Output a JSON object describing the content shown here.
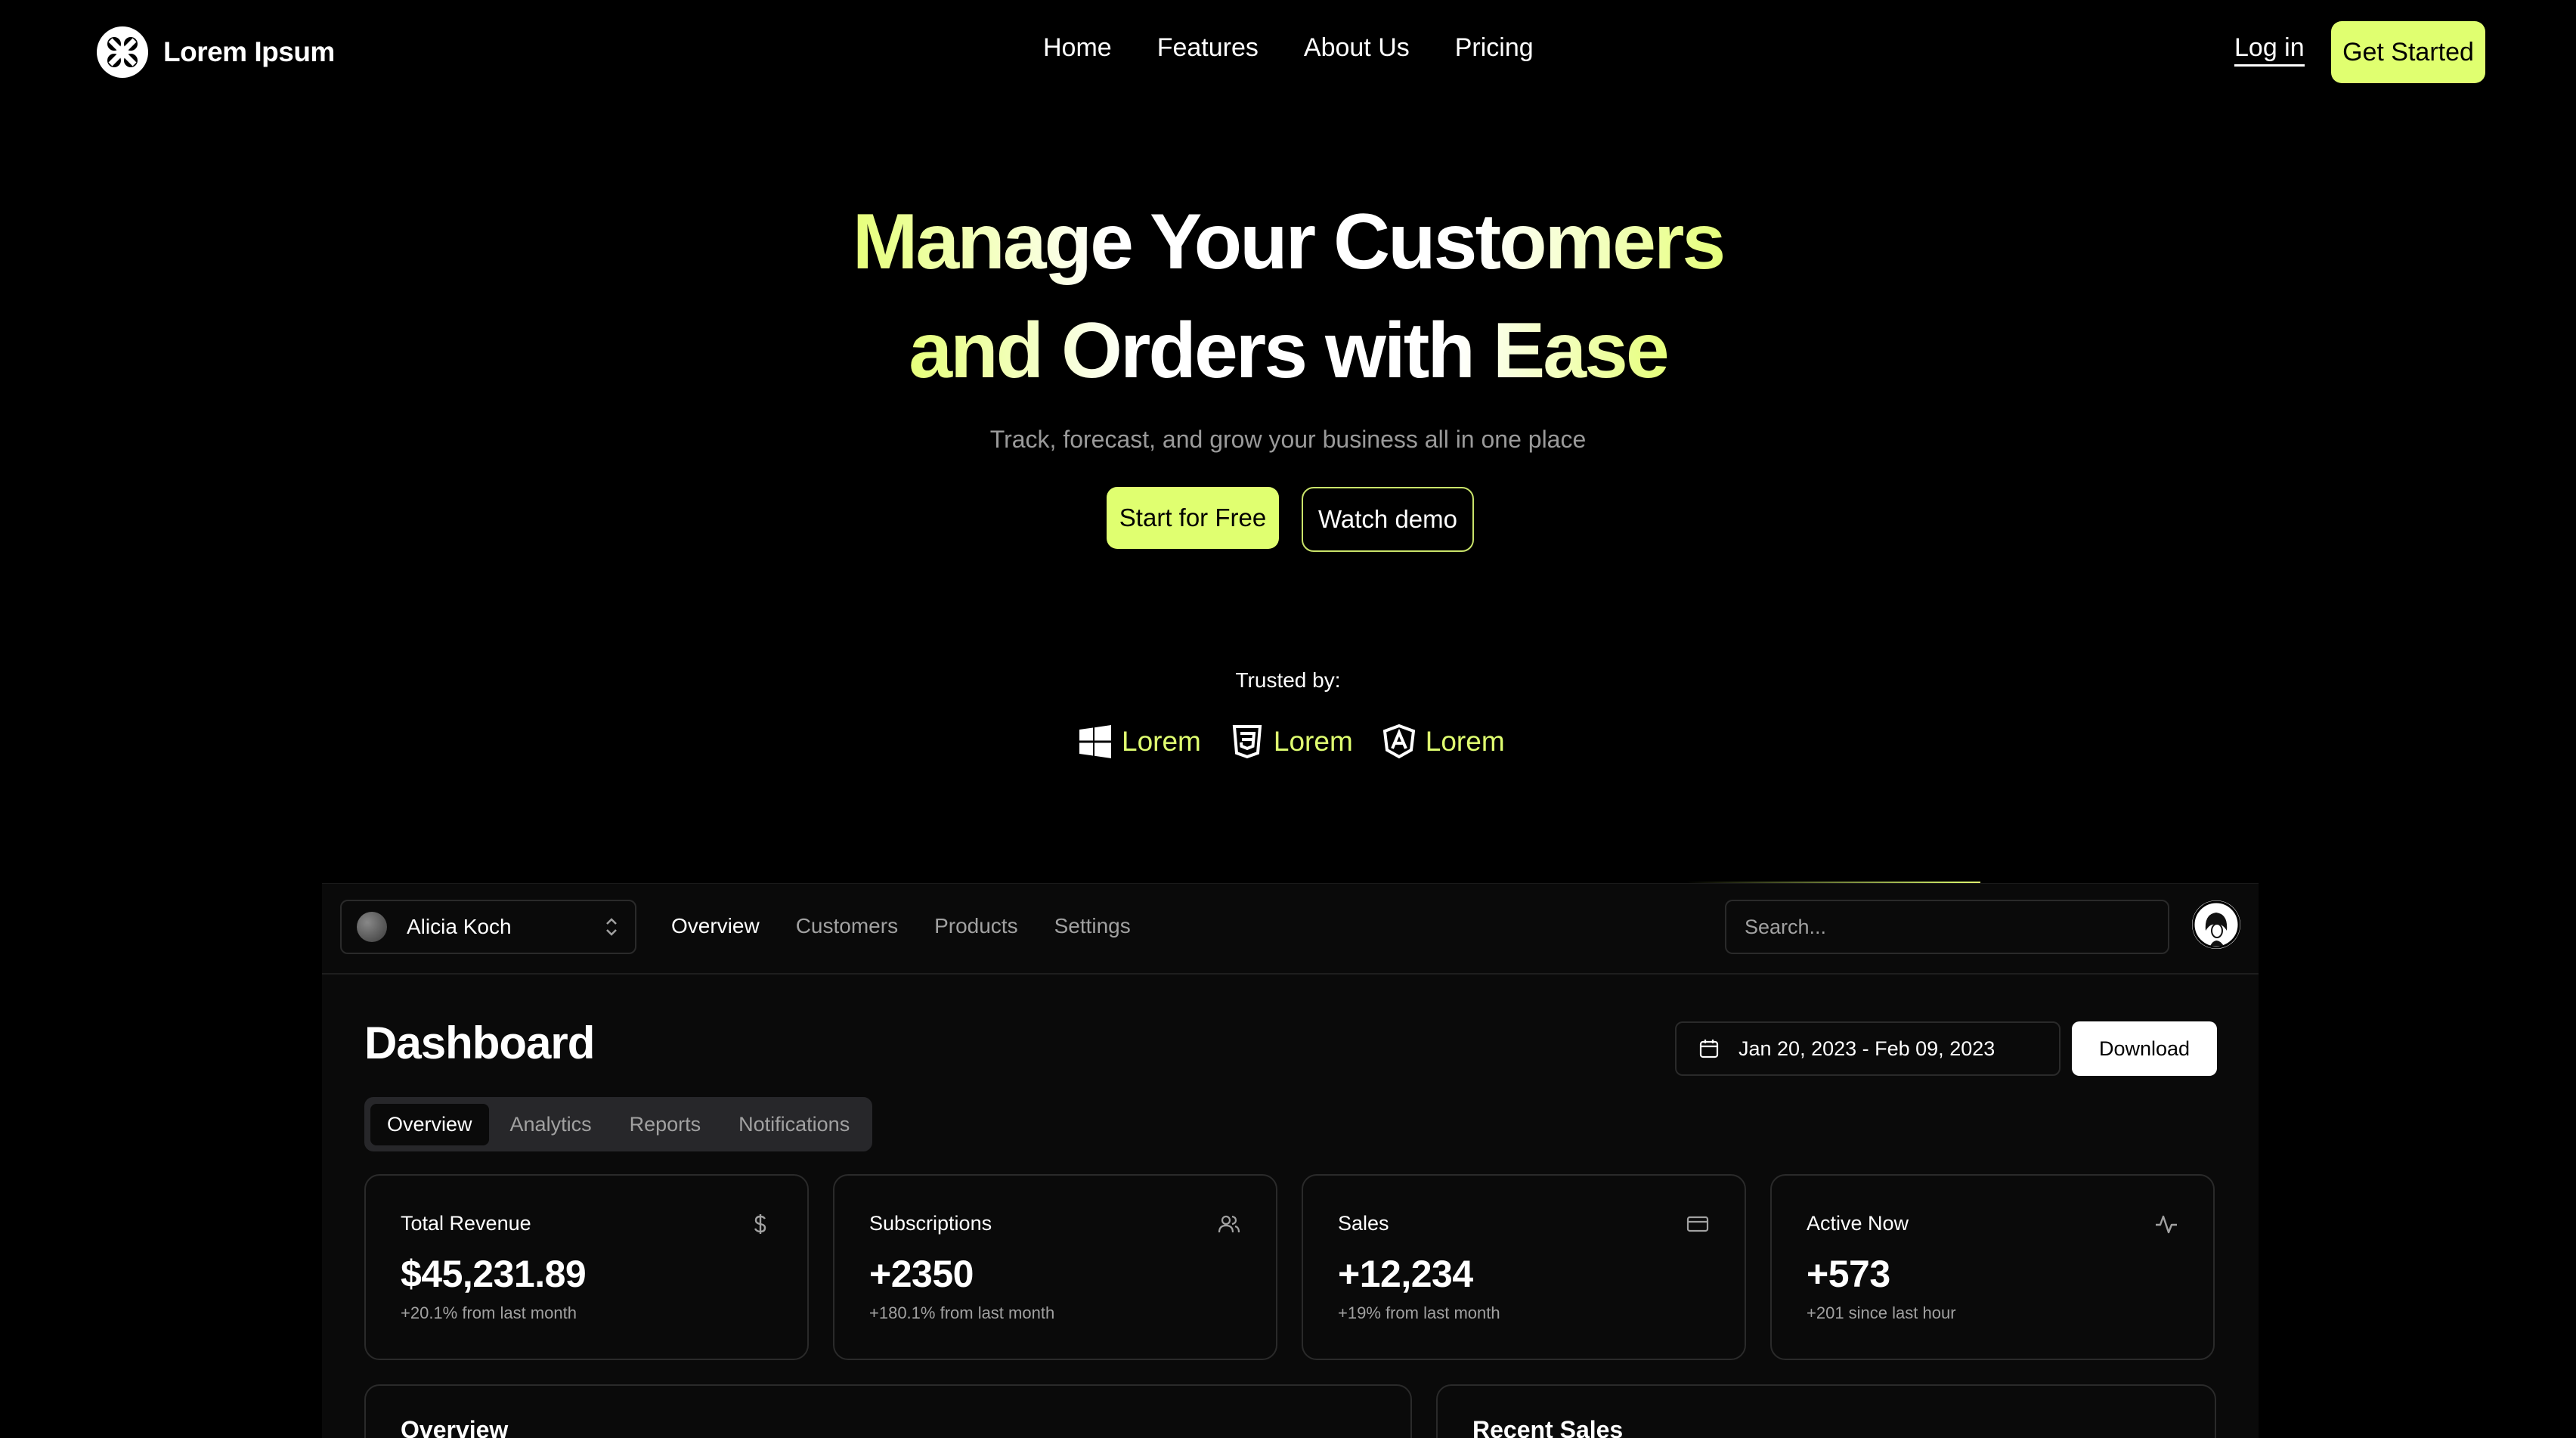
{
  "nav": {
    "brand": "Lorem Ipsum",
    "links": [
      "Home",
      "Features",
      "About Us",
      "Pricing"
    ],
    "login": "Log in",
    "cta": "Get Started"
  },
  "hero": {
    "title_line1": "Manage Your Customers",
    "title_line2": "and Orders with Ease",
    "subtitle": "Track, forecast, and grow your business all in one place",
    "primary_button": "Start for Free",
    "secondary_button": "Watch demo"
  },
  "trusted": {
    "label": "Trusted by:",
    "logos": [
      {
        "icon": "windows-icon",
        "name": "Lorem"
      },
      {
        "icon": "css3-icon",
        "name": "Lorem"
      },
      {
        "icon": "angular-icon",
        "name": "Lorem"
      }
    ]
  },
  "colors": {
    "accent": "#e0ff70",
    "background": "#000000",
    "panel": "#0a0a0a",
    "border": "#2a2a2a",
    "muted": "#a1a1a1"
  },
  "dashboard": {
    "team": "Alicia Koch",
    "nav": [
      "Overview",
      "Customers",
      "Products",
      "Settings"
    ],
    "search_placeholder": "Search...",
    "title": "Dashboard",
    "date_range": "Jan 20, 2023 - Feb 09, 2023",
    "download": "Download",
    "tabs": [
      "Overview",
      "Analytics",
      "Reports",
      "Notifications"
    ],
    "cards": [
      {
        "title": "Total Revenue",
        "value": "$45,231.89",
        "note": "+20.1% from last month",
        "icon": "dollar-icon"
      },
      {
        "title": "Subscriptions",
        "value": "+2350",
        "note": "+180.1% from last month",
        "icon": "users-icon"
      },
      {
        "title": "Sales",
        "value": "+12,234",
        "note": "+19% from last month",
        "icon": "credit-card-icon"
      },
      {
        "title": "Active Now",
        "value": "+573",
        "note": "+201 since last hour",
        "icon": "activity-icon"
      }
    ],
    "overview_title": "Overview",
    "recent_sales_title": "Recent Sales"
  }
}
